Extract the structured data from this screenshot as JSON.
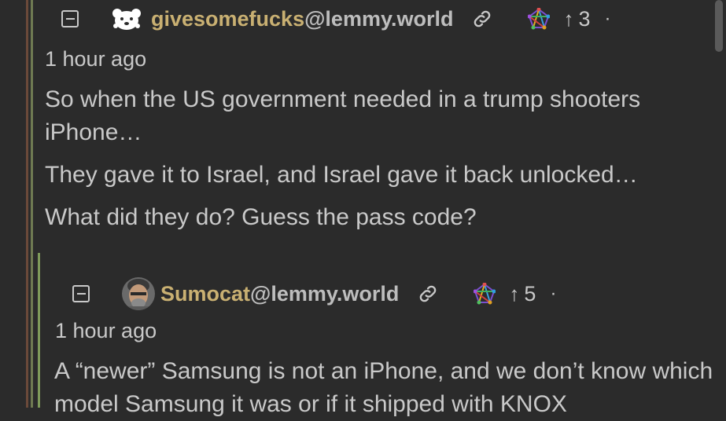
{
  "comments": [
    {
      "username": "givesomefucks",
      "instance": "@lemmy.world",
      "score": "3",
      "time": "1 hour ago",
      "paragraphs": [
        "So when the US government needed in a trump shooters iPhone…",
        "They gave it to Israel, and Israel gave it back unlocked…",
        "What did they do? Guess the pass code?"
      ]
    },
    {
      "username": "Sumocat",
      "instance": "@lemmy.world",
      "score": "5",
      "time": "1 hour ago",
      "paragraphs": [
        "A “newer” Samsung is not an iPhone, and we don’t know which model Samsung it was or if it shipped with KNOX"
      ]
    }
  ],
  "colors": {
    "username": "#c9b072",
    "background": "#2b2b2b",
    "text": "#c9c9c9"
  },
  "icons": [
    "collapse-icon",
    "link-icon",
    "fediverse-icon",
    "upvote-arrow-icon",
    "more-dot-icon"
  ]
}
